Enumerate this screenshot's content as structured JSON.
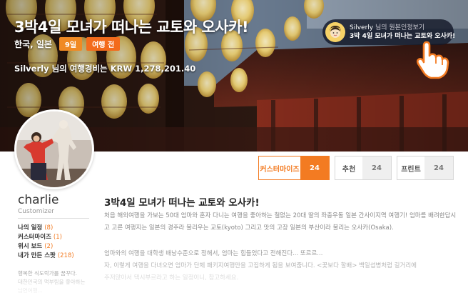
{
  "hero": {
    "title": "3박4일 모녀가 떠나는 교토와 오사카!",
    "location": "한국, 일본",
    "badges": {
      "days": "9일",
      "status": "여행 전"
    },
    "cost": "Silverly 님의 여행경비는 KRW 1,278,201.40"
  },
  "author_pill": {
    "name": "Silverly",
    "suffix": "님의 원본인정보기",
    "trip": "3박 4일 모녀가 떠나는 교토와 오사카!"
  },
  "stats": {
    "customize": {
      "label": "커스터마이즈",
      "count": "24"
    },
    "recommend": {
      "label": "추천",
      "count": "24"
    },
    "print": {
      "label": "프린트",
      "count": "24"
    }
  },
  "profile": {
    "username": "charlie",
    "role": "Customizer",
    "links": [
      {
        "label": "나의 일정",
        "count": "(8)"
      },
      {
        "label": "커스터마이즈",
        "count": "(1)"
      },
      {
        "label": "위시 보드",
        "count": "(2)"
      },
      {
        "label": "내가 만든 스팟",
        "count": "(218)"
      }
    ],
    "bio": [
      "행복한 식도락가를 꿈꾸다.",
      "대한민국의 먹부림을 좋아하는",
      "남연여행..."
    ]
  },
  "main": {
    "title": "3박4일 모녀가 떠나는 교토와 오사카!",
    "para1": "처음 해외여행을 가보는 50대 엄마와 혼자 다니는 여행을 좋아하는 철없는 20대 딸의 좌충우돌 일본 간사이지역 여행기! 엄마를 배려한답시고 고른 여행지는 일본의 경주라 불리우는 교토(kyoto) 그리고 맛의 고장 일본의 부산이라 불리는 오사카(Osaka).",
    "para2": [
      "엄마와의 여행을 대학생 배낭수준으로 정해서, 엄마는 힘들었다고 전해진다... 또르르...",
      "자, 이렇게 여행을 다녀오면 엄마가 단체 패키지여행만을 고집하게 됨을 보여줍니다. <꽃보다 할배> 백일섭병처럼 길거리에",
      "주저앉아서 택시부르라고 하는 일정이니, 참고하세요."
    ]
  },
  "colors": {
    "accent": "#f37b22",
    "badge_days": "#f08a24",
    "pill_bg": "#141828"
  }
}
